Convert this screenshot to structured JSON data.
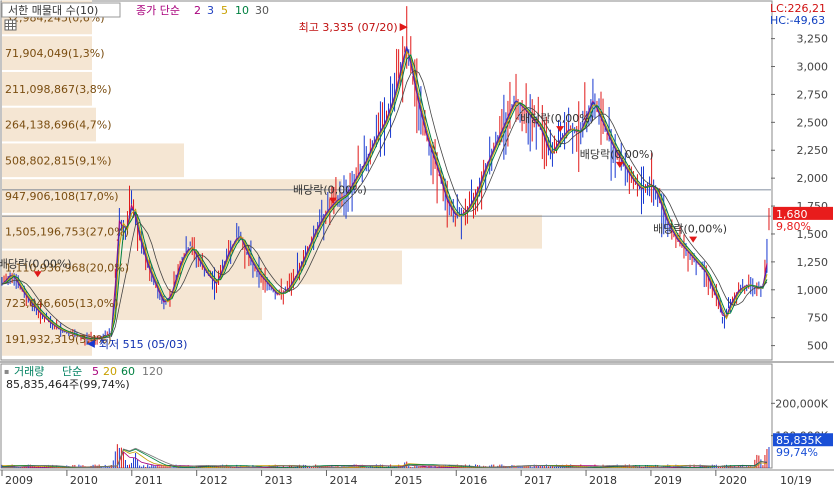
{
  "chart_data": {
    "type": "stock-candlestick",
    "title": "서한 매물대 수(10)",
    "legend_prefix": "종가 단순",
    "ma_periods": [
      "2",
      "3",
      "5",
      "10",
      "30"
    ],
    "volume_title": "거래량",
    "volume_legend_prefix": "단순",
    "volume_ma_periods": [
      "5",
      "20",
      "60",
      "120"
    ],
    "volume_total_label": "85,835,464주(99,74%)",
    "lc_label": "LC:226,21",
    "hc_label": "HC:-49,63",
    "current_price_label": "1,680",
    "current_pct_label": "9,80%",
    "current_price": 1680,
    "current_volume_label": "85,835K",
    "current_volume_pct_label": "99,74%",
    "current_volume": 85835,
    "x_ticks": [
      "2009",
      "2010",
      "2011",
      "2012",
      "2013",
      "2014",
      "2015",
      "2016",
      "2017",
      "2018",
      "2019",
      "2020"
    ],
    "x_end_label": "10/19",
    "price_axis_ticks": [
      {
        "value": 500,
        "label": "500"
      },
      {
        "value": 750,
        "label": "750"
      },
      {
        "value": 1000,
        "label": "1,000"
      },
      {
        "value": 1250,
        "label": "1,250"
      },
      {
        "value": 1500,
        "label": "1,500"
      },
      {
        "value": 1750,
        "label": "1,750"
      },
      {
        "value": 2000,
        "label": "2,000"
      },
      {
        "value": 2250,
        "label": "2,250"
      },
      {
        "value": 2500,
        "label": "2,500"
      },
      {
        "value": 2750,
        "label": "2,750"
      },
      {
        "value": 3000,
        "label": "3,000"
      },
      {
        "value": 3250,
        "label": "3,250"
      }
    ],
    "price_ylim": [
      380,
      3560
    ],
    "volume_axis_ticks": [
      {
        "value": 100000,
        "label": "100,000K"
      },
      {
        "value": 200000,
        "label": "200,000K"
      }
    ],
    "volume_ylim": [
      0,
      235000
    ],
    "volume_profile": [
      {
        "price_low": 400,
        "price_high": 720,
        "label": "191,932,319(3,4%)",
        "pct": 3.4
      },
      {
        "price_low": 720,
        "price_high": 1040,
        "label": "723,046,605(13,0%)",
        "pct": 13.0
      },
      {
        "price_low": 1040,
        "price_high": 1360,
        "label": "1,110,936,968(20,0%)",
        "pct": 20.0
      },
      {
        "price_low": 1360,
        "price_high": 1680,
        "label": "1,505,196,753(27,0%)",
        "pct": 27.0
      },
      {
        "price_low": 1680,
        "price_high": 2000,
        "label": "947,906,108(17,0%)",
        "pct": 17.0
      },
      {
        "price_low": 2000,
        "price_high": 2320,
        "label": "508,802,815(9,1%)",
        "pct": 9.1
      },
      {
        "price_low": 2320,
        "price_high": 2640,
        "label": "264,138,696(4,7%)",
        "pct": 4.7
      },
      {
        "price_low": 2640,
        "price_high": 2960,
        "label": "211,098,867(3,8%)",
        "pct": 3.8
      },
      {
        "price_low": 2960,
        "price_high": 3280,
        "label": "71,904,049(1,3%)",
        "pct": 1.3
      },
      {
        "price_low": 3280,
        "price_high": 3600,
        "label": "32,984,245(0,6%)",
        "pct": 0.6
      }
    ],
    "highlight_levels": [
      1660,
      1895
    ],
    "price_series": [
      [
        2009.0,
        1050
      ],
      [
        2009.15,
        1150
      ],
      [
        2009.3,
        1000
      ],
      [
        2009.45,
        880
      ],
      [
        2009.6,
        780
      ],
      [
        2009.75,
        700
      ],
      [
        2009.9,
        640
      ],
      [
        2010.1,
        600
      ],
      [
        2010.3,
        560
      ],
      [
        2010.45,
        560
      ],
      [
        2010.6,
        590
      ],
      [
        2010.7,
        620
      ],
      [
        2010.75,
        1200
      ],
      [
        2010.8,
        1650
      ],
      [
        2010.9,
        1500
      ],
      [
        2011.0,
        1800
      ],
      [
        2011.1,
        1500
      ],
      [
        2011.25,
        1200
      ],
      [
        2011.4,
        1000
      ],
      [
        2011.5,
        870
      ],
      [
        2011.6,
        950
      ],
      [
        2011.75,
        1250
      ],
      [
        2011.9,
        1400
      ],
      [
        2012.0,
        1300
      ],
      [
        2012.15,
        1150
      ],
      [
        2012.3,
        1050
      ],
      [
        2012.5,
        1350
      ],
      [
        2012.65,
        1500
      ],
      [
        2012.8,
        1300
      ],
      [
        2012.95,
        1150
      ],
      [
        2013.1,
        1050
      ],
      [
        2013.25,
        950
      ],
      [
        2013.4,
        1000
      ],
      [
        2013.55,
        1150
      ],
      [
        2013.7,
        1350
      ],
      [
        2013.85,
        1550
      ],
      [
        2014.0,
        1700
      ],
      [
        2014.15,
        1800
      ],
      [
        2014.3,
        1850
      ],
      [
        2014.45,
        2000
      ],
      [
        2014.6,
        2150
      ],
      [
        2014.75,
        2350
      ],
      [
        2014.9,
        2500
      ],
      [
        2015.05,
        2750
      ],
      [
        2015.15,
        3000
      ],
      [
        2015.22,
        3200
      ],
      [
        2015.3,
        3000
      ],
      [
        2015.4,
        2700
      ],
      [
        2015.55,
        2350
      ],
      [
        2015.7,
        2100
      ],
      [
        2015.85,
        1800
      ],
      [
        2016.0,
        1650
      ],
      [
        2016.15,
        1700
      ],
      [
        2016.3,
        1850
      ],
      [
        2016.45,
        2100
      ],
      [
        2016.6,
        2300
      ],
      [
        2016.75,
        2500
      ],
      [
        2016.9,
        2700
      ],
      [
        2017.0,
        2650
      ],
      [
        2017.15,
        2550
      ],
      [
        2017.3,
        2450
      ],
      [
        2017.45,
        2200
      ],
      [
        2017.6,
        2350
      ],
      [
        2017.75,
        2450
      ],
      [
        2017.9,
        2400
      ],
      [
        2018.0,
        2550
      ],
      [
        2018.1,
        2700
      ],
      [
        2018.25,
        2500
      ],
      [
        2018.4,
        2300
      ],
      [
        2018.55,
        2150
      ],
      [
        2018.7,
        2000
      ],
      [
        2018.85,
        1900
      ],
      [
        2019.0,
        1950
      ],
      [
        2019.1,
        1850
      ],
      [
        2019.25,
        1600
      ],
      [
        2019.4,
        1450
      ],
      [
        2019.55,
        1350
      ],
      [
        2019.7,
        1250
      ],
      [
        2019.85,
        1150
      ],
      [
        2019.95,
        1000
      ],
      [
        2020.05,
        880
      ],
      [
        2020.12,
        700
      ],
      [
        2020.2,
        850
      ],
      [
        2020.35,
        1000
      ],
      [
        2020.5,
        1050
      ],
      [
        2020.6,
        1020
      ],
      [
        2020.7,
        1000
      ],
      [
        2020.75,
        1100
      ],
      [
        2020.8,
        1350
      ],
      [
        2020.83,
        1680
      ]
    ],
    "volume_spikes": [
      {
        "x": 2010.78,
        "value": 135000
      },
      {
        "x": 2010.85,
        "value": 85000
      },
      {
        "x": 2011.05,
        "value": 60000
      },
      {
        "x": 2015.22,
        "value": 25000
      },
      {
        "x": 2020.65,
        "value": 60000
      },
      {
        "x": 2020.8,
        "value": 85835
      }
    ],
    "annotations": {
      "max_label": "최고 3,335 (07/20)",
      "max_price": 3335,
      "max_x": 2015.22,
      "min_label": "최저 515 (05/03)",
      "min_price": 515,
      "min_x": 2010.4,
      "dividend_label": "배당락(0,00%)",
      "dividends": [
        {
          "x": 2009.55,
          "price": 1130
        },
        {
          "x": 2014.1,
          "price": 1790
        },
        {
          "x": 2017.6,
          "price": 2430
        },
        {
          "x": 2018.52,
          "price": 2110
        },
        {
          "x": 2019.65,
          "price": 1440
        }
      ]
    }
  }
}
